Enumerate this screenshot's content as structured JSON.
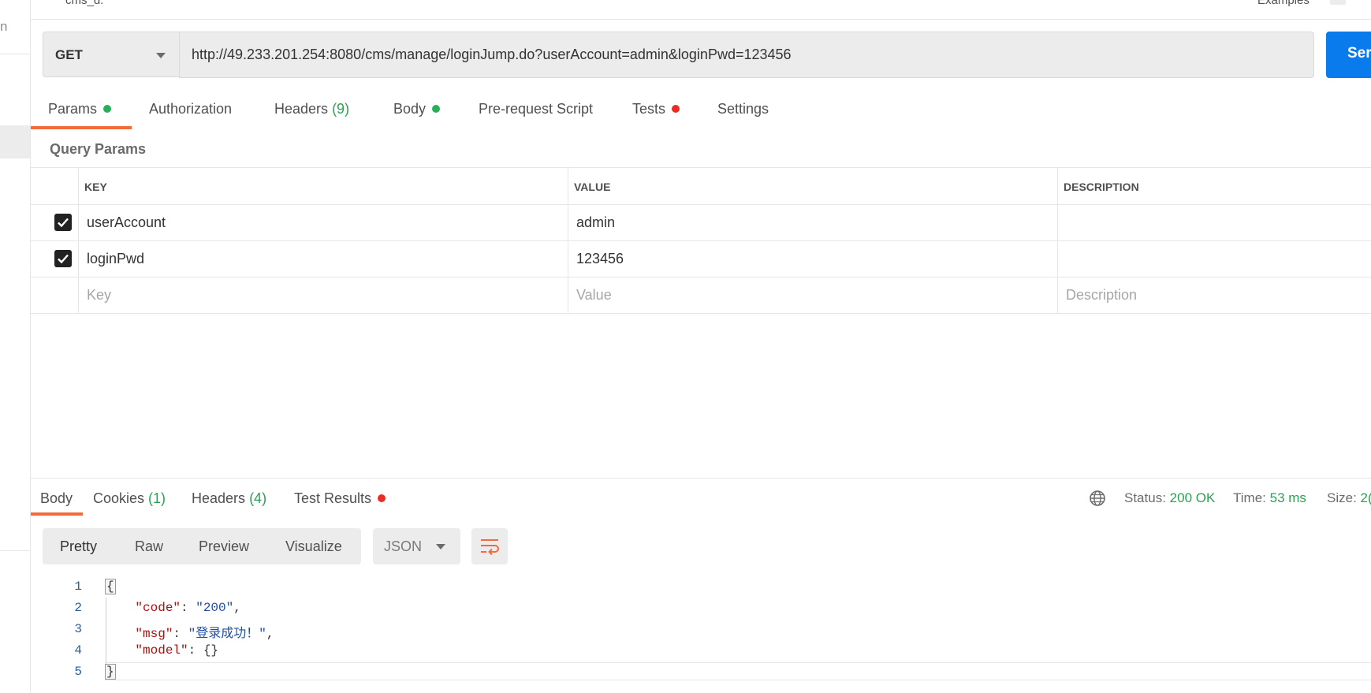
{
  "sidebar": {
    "letter": "n"
  },
  "top": {
    "request_name": "cms_d.",
    "examples_label": "Examples"
  },
  "request": {
    "method": "GET",
    "url": "http://49.233.201.254:8080/cms/manage/loginJump.do?userAccount=admin&loginPwd=123456",
    "send_label": "Ser"
  },
  "tabs": {
    "params": "Params",
    "authorization": "Authorization",
    "headers": "Headers",
    "headers_count": "(9)",
    "body": "Body",
    "prerequest": "Pre-request Script",
    "tests": "Tests",
    "settings": "Settings"
  },
  "query_params": {
    "title": "Query Params",
    "columns": {
      "key": "KEY",
      "value": "VALUE",
      "description": "DESCRIPTION"
    },
    "rows": [
      {
        "key": "userAccount",
        "value": "admin",
        "checked": true
      },
      {
        "key": "loginPwd",
        "value": "123456",
        "checked": true
      }
    ],
    "placeholders": {
      "key": "Key",
      "value": "Value",
      "description": "Description"
    }
  },
  "response": {
    "tabs": {
      "body": "Body",
      "cookies": "Cookies",
      "cookies_count": "(1)",
      "headers": "Headers",
      "headers_count": "(4)",
      "test_results": "Test Results"
    },
    "status_label": "Status:",
    "status_value": "200 OK",
    "time_label": "Time:",
    "time_value": "53 ms",
    "size_label": "Size:",
    "size_value": "2(",
    "views": {
      "pretty": "Pretty",
      "raw": "Raw",
      "preview": "Preview",
      "visualize": "Visualize"
    },
    "format": "JSON",
    "code": {
      "line_numbers": [
        "1",
        "2",
        "3",
        "4",
        "5"
      ],
      "open": "{",
      "close": "}",
      "code_key": "\"code\"",
      "code_val": "\"200\"",
      "msg_key": "\"msg\"",
      "msg_val": "\"登录成功！\"",
      "model_key": "\"model\"",
      "model_val": "{}"
    }
  },
  "colors": {
    "accent": "#f26b3a",
    "send": "#097bed",
    "green": "#2aa153",
    "red": "#ed2b25"
  }
}
